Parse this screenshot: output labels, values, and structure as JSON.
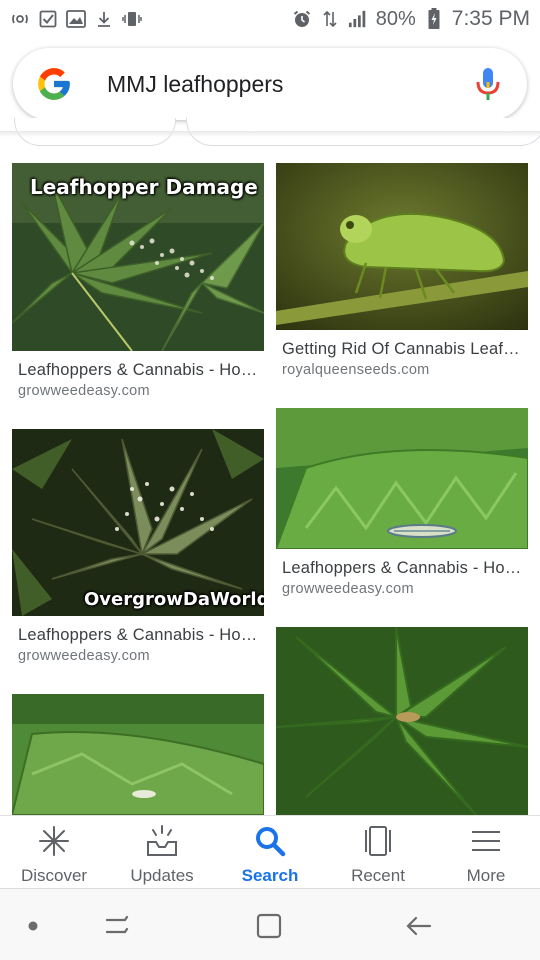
{
  "status_bar": {
    "battery_percent": "80%",
    "time": "7:35 PM"
  },
  "search": {
    "query": "MMJ leafhoppers"
  },
  "results": [
    {
      "title": "Leafhoppers & Cannabis - Ho…",
      "domain": "growweedeasy.com",
      "overlay": "Leafhopper Damage"
    },
    {
      "title": "Getting Rid Of Cannabis Leaf…",
      "domain": "royalqueenseeds.com"
    },
    {
      "title": "Leafhoppers & Cannabis - Ho…",
      "domain": "growweedeasy.com",
      "overlay": "OvergrowDaWorld"
    },
    {
      "title": "Leafhoppers & Cannabis - Ho…",
      "domain": "growweedeasy.com"
    }
  ],
  "bottom_nav": {
    "items": [
      {
        "label": "Discover",
        "icon": "asterisk-icon"
      },
      {
        "label": "Updates",
        "icon": "inbox-icon"
      },
      {
        "label": "Search",
        "icon": "search-icon",
        "active": true
      },
      {
        "label": "Recent",
        "icon": "recent-cards-icon"
      },
      {
        "label": "More",
        "icon": "menu-icon"
      }
    ]
  },
  "colors": {
    "accent": "#1a73e8",
    "text_primary": "#3c4043",
    "text_secondary": "#70757a"
  }
}
